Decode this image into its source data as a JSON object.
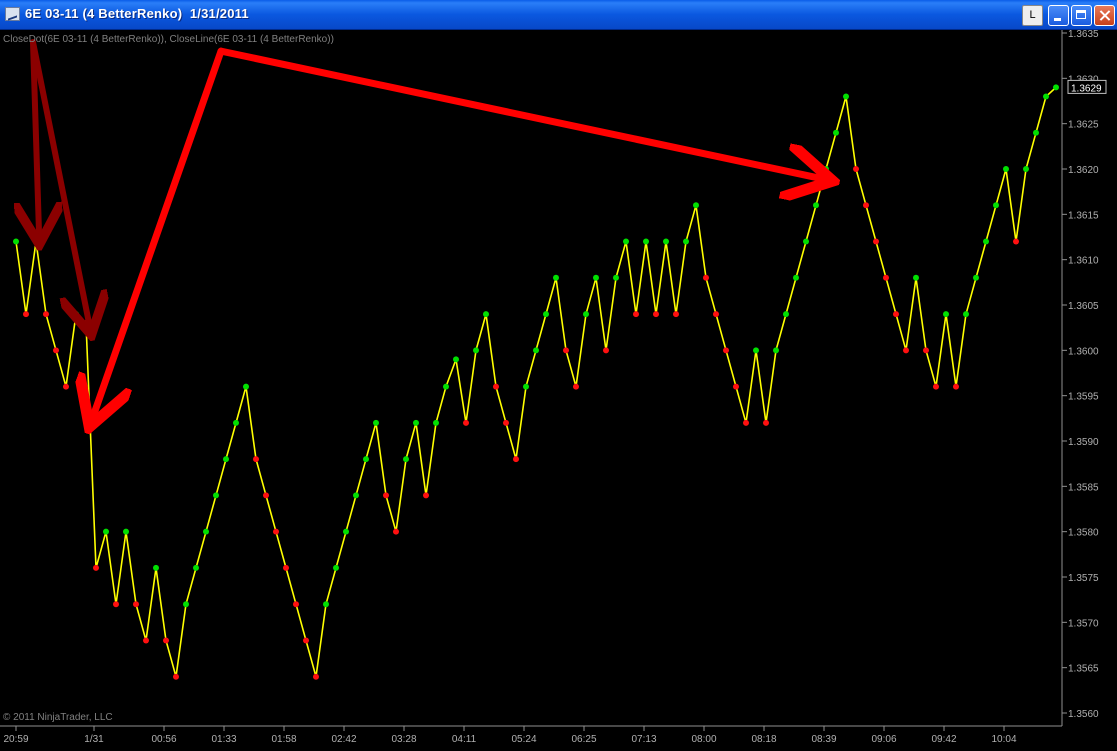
{
  "window": {
    "title": "6E 03-11 (4 BetterRenko)  1/31/2011",
    "layout_button_label": "L"
  },
  "indicator_label": "CloseDot(6E 03-11 (4 BetterRenko)), CloseLine(6E 03-11 (4 BetterRenko))",
  "copyright": "© 2011 NinjaTrader, LLC",
  "colors": {
    "background": "#000000",
    "line": "#ffff00",
    "up_dot": "#00e000",
    "down_dot": "#ff1010",
    "arrow": "#ff0000",
    "arrow_dark": "#8b0000"
  },
  "chart_data": {
    "type": "line",
    "ylim": [
      1.3558,
      1.3637
    ],
    "y_ticks": [
      "1.3635",
      "1.3630",
      "1.3625",
      "1.3620",
      "1.3615",
      "1.3610",
      "1.3605",
      "1.3600",
      "1.3595",
      "1.3590",
      "1.3585",
      "1.3580",
      "1.3575",
      "1.3570",
      "1.3565",
      "1.3560"
    ],
    "x_ticks": [
      {
        "label": "20:59",
        "bar": 0
      },
      {
        "label": "1/31",
        "bar": 7.8
      },
      {
        "label": "00:56",
        "bar": 14.8
      },
      {
        "label": "01:33",
        "bar": 20.8
      },
      {
        "label": "01:58",
        "bar": 26.8
      },
      {
        "label": "02:42",
        "bar": 32.8
      },
      {
        "label": "03:28",
        "bar": 38.8
      },
      {
        "label": "04:11",
        "bar": 44.8
      },
      {
        "label": "05:24",
        "bar": 50.8
      },
      {
        "label": "06:25",
        "bar": 56.8
      },
      {
        "label": "07:13",
        "bar": 62.8
      },
      {
        "label": "08:00",
        "bar": 68.8
      },
      {
        "label": "08:18",
        "bar": 74.8
      },
      {
        "label": "08:39",
        "bar": 80.8
      },
      {
        "label": "09:06",
        "bar": 86.8
      },
      {
        "label": "09:42",
        "bar": 92.8
      },
      {
        "label": "10:04",
        "bar": 98.8
      }
    ],
    "closes": [
      1.3612,
      1.3604,
      1.3612,
      1.3604,
      1.36,
      1.3596,
      1.3604,
      1.3603,
      1.3576,
      1.358,
      1.3572,
      1.358,
      1.3572,
      1.3568,
      1.3576,
      1.3568,
      1.3564,
      1.3572,
      1.3576,
      1.358,
      1.3584,
      1.3588,
      1.3592,
      1.3596,
      1.3588,
      1.3584,
      1.358,
      1.3576,
      1.3572,
      1.3568,
      1.3564,
      1.3572,
      1.3576,
      1.358,
      1.3584,
      1.3588,
      1.3592,
      1.3584,
      1.358,
      1.3588,
      1.3592,
      1.3584,
      1.3592,
      1.3596,
      1.3599,
      1.3592,
      1.36,
      1.3604,
      1.3596,
      1.3592,
      1.3588,
      1.3596,
      1.36,
      1.3604,
      1.3608,
      1.36,
      1.3596,
      1.3604,
      1.3608,
      1.36,
      1.3608,
      1.3612,
      1.3604,
      1.3612,
      1.3604,
      1.3612,
      1.3604,
      1.3612,
      1.3616,
      1.3608,
      1.3604,
      1.36,
      1.3596,
      1.3592,
      1.36,
      1.3592,
      1.36,
      1.3604,
      1.3608,
      1.3612,
      1.3616,
      1.362,
      1.3624,
      1.3628,
      1.362,
      1.3616,
      1.3612,
      1.3608,
      1.3604,
      1.36,
      1.3608,
      1.36,
      1.3596,
      1.3604,
      1.3596,
      1.3604,
      1.3608,
      1.3612,
      1.3616,
      1.362,
      1.3612,
      1.362,
      1.3624,
      1.3628,
      1.3629
    ],
    "last_price_label": "1.3629"
  },
  "annotations": {
    "arrows": [
      {
        "color": "dark",
        "from": {
          "bar": 1.7,
          "price": 1.3634
        },
        "to": {
          "bar": 2.3,
          "price": 1.3613
        }
      },
      {
        "color": "dark",
        "from": {
          "bar": 1.7,
          "price": 1.3634
        },
        "to": {
          "bar": 7.3,
          "price": 1.3603
        }
      },
      {
        "color": "red",
        "from": {
          "bar": 20.5,
          "price": 1.3633
        },
        "to": {
          "bar": 7.8,
          "price": 1.3593
        }
      },
      {
        "color": "red",
        "from": {
          "bar": 20.5,
          "price": 1.3633
        },
        "to": {
          "bar": 80.3,
          "price": 1.3619
        }
      }
    ]
  }
}
